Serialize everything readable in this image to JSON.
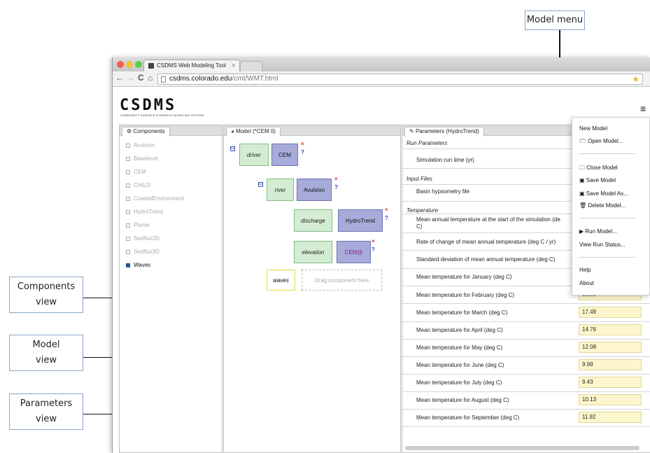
{
  "callouts": {
    "model_menu": "Model menu",
    "components_view_1": "Components",
    "components_view_2": "view",
    "model_view_1": "Model",
    "model_view_2": "view",
    "parameters_view_1": "Parameters",
    "parameters_view_2": "view"
  },
  "browser": {
    "tab_title": "CSDMS Web Modeling Tool",
    "tab_close": "×",
    "url_host": "csdms.colorado.edu",
    "url_path": "/cmt/WMT.html",
    "back": "←",
    "forward": "→",
    "reload": "C",
    "home": "⌂",
    "star": "★"
  },
  "logo": {
    "text": "CSDMS",
    "subtitle": "COMMUNITY SURFACE DYNAMICS MODELING SYSTEM"
  },
  "components_panel": {
    "tab": "Components",
    "items": [
      {
        "label": "Avulsion",
        "active": false
      },
      {
        "label": "Baselevel",
        "active": false
      },
      {
        "label": "CEM",
        "active": false
      },
      {
        "label": "CHILD",
        "active": false
      },
      {
        "label": "CoastalEnvironment",
        "active": false
      },
      {
        "label": "HydroTrend",
        "active": false
      },
      {
        "label": "Plume",
        "active": false
      },
      {
        "label": "Sedflux2D",
        "active": false
      },
      {
        "label": "Sedflux3D",
        "active": false
      },
      {
        "label": "Waves",
        "active": true
      }
    ]
  },
  "model_panel": {
    "tab": "Model (*CEM 0)",
    "toggle": "⊟",
    "close": "×",
    "help": "?",
    "nodes": {
      "driver_port": "driver",
      "driver_comp": "CEM",
      "river_port": "river",
      "river_comp": "Avulsion",
      "discharge_port": "discharge",
      "discharge_comp": "HydroTrend",
      "elevation_port": "elevation",
      "elevation_comp": "CEM@",
      "waves_port": "waves",
      "drop_hint": "Drag component here"
    }
  },
  "parameters_panel": {
    "tab": "Parameters (HydroTrend)",
    "sections": {
      "run": "Run Parameters",
      "input": "Input Files",
      "temperature": "Temperature"
    },
    "run_params": [
      "Simulation run time (yr)"
    ],
    "input_params": [
      "Basin hypsometry file"
    ],
    "temp_params": [
      {
        "label": "Mean annual temperature at the start of the simulation (de",
        "label2": "C)",
        "value": ""
      },
      {
        "label": "Rate of change of mean annual temperature (deg C / yr)",
        "value": ""
      },
      {
        "label": "Standard deviation of mean annual temperature (deg C)",
        "value": ""
      },
      {
        "label": "Mean temperature for January (deg C)",
        "value": ""
      },
      {
        "label": "Mean temperature for February (deg C)",
        "value": "18.85"
      },
      {
        "label": "Mean temperature for March (deg C)",
        "value": "17.49"
      },
      {
        "label": "Mean temperature for April (deg C)",
        "value": "14.76"
      },
      {
        "label": "Mean temperature for May (deg C)",
        "value": "12.08"
      },
      {
        "label": "Mean temperature for June (deg C)",
        "value": "9.99"
      },
      {
        "label": "Mean temperature for July (deg C)",
        "value": "9.43"
      },
      {
        "label": "Mean temperature for August (deg C)",
        "value": "10.13"
      },
      {
        "label": "Mean temperature for September (deg C)",
        "value": "11.92"
      }
    ]
  },
  "model_menu": {
    "icon": "≡",
    "items": {
      "new": "New Model",
      "open": "Open Model...",
      "close": "Close Model",
      "save": "Save Model",
      "save_as": "Save Model As...",
      "delete": "Delete Model...",
      "run": "Run Model...",
      "status": "View Run Status...",
      "help": "Help",
      "about": "About"
    }
  }
}
